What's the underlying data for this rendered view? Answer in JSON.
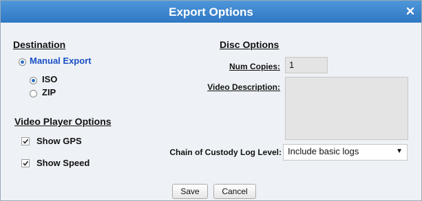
{
  "dialog": {
    "title": "Export Options",
    "close_icon": "close-icon"
  },
  "destination": {
    "heading": "Destination",
    "manual_export_label": "Manual Export",
    "iso_label": "ISO",
    "zip_label": "ZIP",
    "selected_destination": "Manual Export",
    "selected_format": "ISO"
  },
  "video_player": {
    "heading": "Video Player Options",
    "show_gps_label": "Show GPS",
    "show_speed_label": "Show Speed",
    "show_gps_checked": true,
    "show_speed_checked": true
  },
  "disc": {
    "heading": "Disc Options",
    "num_copies_label": "Num Copies:",
    "num_copies_value": "1",
    "video_description_label": "Video Description:",
    "video_description_value": ""
  },
  "custody": {
    "label": "Chain of Custody Log Level:",
    "selected_value": "Include basic logs"
  },
  "buttons": {
    "save_label": "Save",
    "cancel_label": "Cancel"
  },
  "colors": {
    "title_bar": "#3a84cf",
    "background": "#eef2f6",
    "link_blue": "#1a4fc4"
  }
}
